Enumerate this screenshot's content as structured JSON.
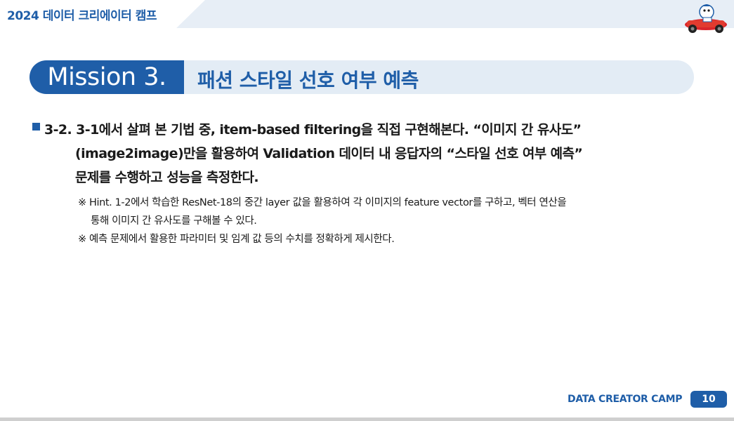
{
  "header": {
    "title": "2024 데이터 크리에이터 캠프",
    "mascot_icon": "race-car-mascot-icon"
  },
  "mission": {
    "label": "Mission 3.",
    "heading": "패션 스타일 선호 여부 예측"
  },
  "task": {
    "lines": [
      "3-2. 3-1에서 살펴 본 기법 중, item-based filtering을 직접 구현해본다. “이미지 간 유사도”",
      "(image2image)만을 활용하여 Validation 데이터 내 응답자의 “스타일 선호 여부 예측”",
      "문제를 수행하고 성능을 측정한다."
    ]
  },
  "hints": [
    "※ Hint. 1-2에서 학습한 ResNet-18의 중간 layer 값을 활용하여 각 이미지의 feature vector를 구하고, 벡터 연산을",
    "통해 이미지 간 유사도를 구해볼 수 있다.",
    "※ 예측 문제에서 활용한 파라미터 및 임계 값 등의 수치를 정확하게 제시한다."
  ],
  "footer": {
    "brand": "DATA CREATOR CAMP",
    "page_number": "10"
  },
  "colors": {
    "accent": "#1f5ea8",
    "band": "#e7eef6"
  }
}
